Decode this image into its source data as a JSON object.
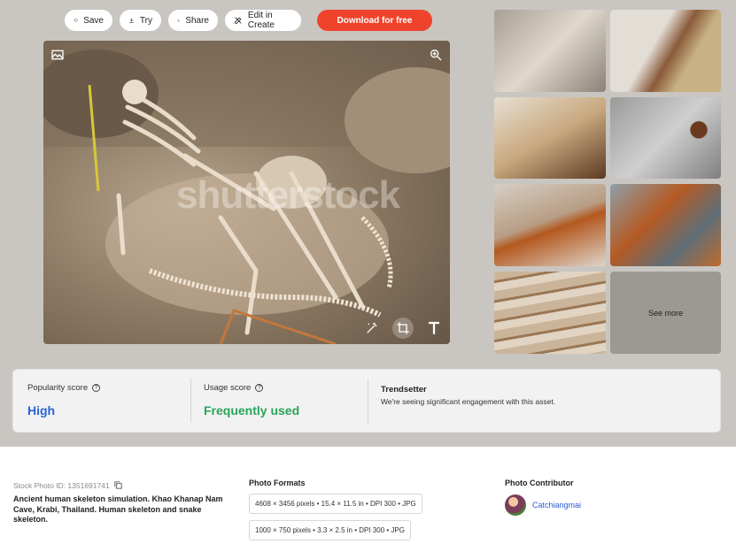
{
  "toolbar": {
    "save_label": "Save",
    "try_label": "Try",
    "share_label": "Share",
    "edit_label": "Edit in Create",
    "download_label": "Download for free"
  },
  "image": {
    "watermark": "shutterstock"
  },
  "thumbnails": {
    "see_more_label": "See more"
  },
  "scores": {
    "popularity_label": "Popularity score",
    "popularity_value": "High",
    "popularity_color": "#2a62d8",
    "usage_label": "Usage score",
    "usage_value": "Frequently used",
    "usage_color": "#2aa45b",
    "trend_title": "Trendsetter",
    "trend_desc": "We're seeing significant engagement with this asset."
  },
  "details": {
    "stock_id": "Stock Photo ID: 1351691741",
    "description": "Ancient human skeleton simulation. Khao Khanap Nam Cave, Krabi, Thailand. Human skeleton and snake skeleton."
  },
  "formats": {
    "title": "Photo Formats",
    "items": [
      "4608 × 3456 pixels • 15.4 × 11.5 in • DPI 300 • JPG",
      "1000 × 750 pixels • 3.3 × 2.5 in • DPI 300 • JPG"
    ]
  },
  "contributor": {
    "title": "Photo Contributor",
    "name": "Catchiangmai"
  },
  "colors": {
    "download_bg": "#f0432b",
    "link": "#2a5bd7"
  }
}
